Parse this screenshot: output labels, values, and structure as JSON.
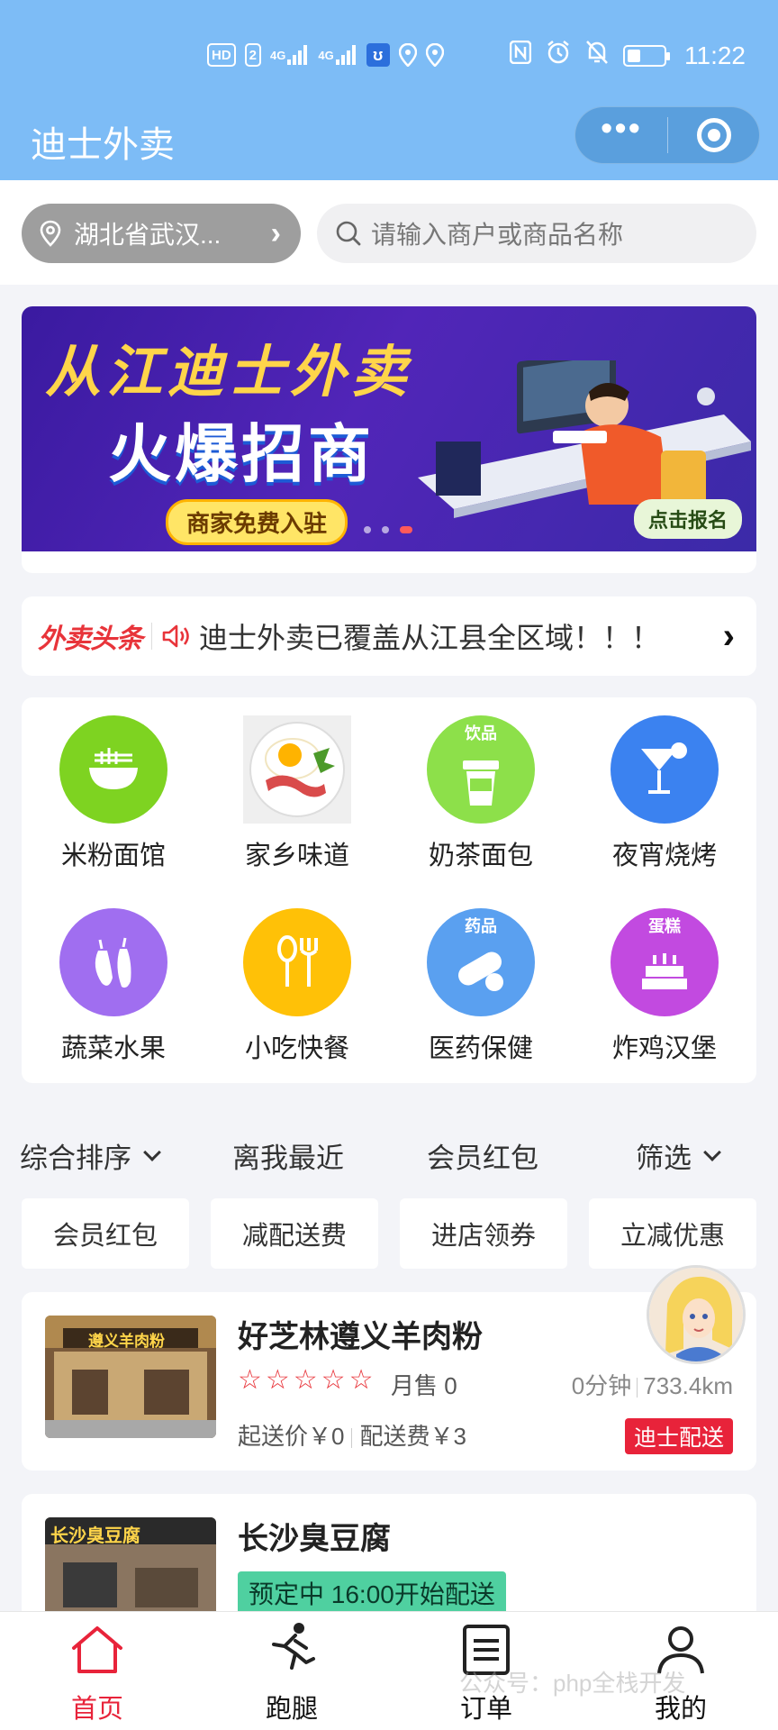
{
  "status": {
    "left_badges": [
      "HD",
      "2",
      "4G",
      "4G"
    ],
    "time": "11:22"
  },
  "header": {
    "title": "迪士外卖",
    "more_label": "•••"
  },
  "location": {
    "text": "湖北省武汉..."
  },
  "search": {
    "placeholder": "请输入商户或商品名称"
  },
  "banner": {
    "line1": "从江迪士外卖",
    "line2": "火爆招商",
    "button": "商家免费入驻",
    "signup": "点击报名"
  },
  "news": {
    "brand": "外卖头条",
    "message": "迪士外卖已覆盖从江县全区域！！！"
  },
  "categories": [
    {
      "label": "米粉面馆",
      "icon": "noodle-bowl-icon",
      "color": "#7ed321"
    },
    {
      "label": "家乡味道",
      "icon": "egg-bacon-icon",
      "color": "#f5f5f5"
    },
    {
      "label": "奶茶面包",
      "icon": "milk-tea-icon",
      "color": "#8de04a",
      "tag": "饮品"
    },
    {
      "label": "夜宵烧烤",
      "icon": "cocktail-icon",
      "color": "#3b82f0"
    },
    {
      "label": "蔬菜水果",
      "icon": "eggplant-icon",
      "color": "#a06ef0"
    },
    {
      "label": "小吃快餐",
      "icon": "spoon-fork-icon",
      "color": "#ffc107"
    },
    {
      "label": "医药保健",
      "icon": "pill-icon",
      "color": "#5aa0f0",
      "tag": "药品"
    },
    {
      "label": "炸鸡汉堡",
      "icon": "cake-icon",
      "color": "#c24ae0",
      "tag": "蛋糕"
    }
  ],
  "sort": {
    "items": [
      "综合排序",
      "离我最近",
      "会员红包",
      "筛选"
    ]
  },
  "chips": [
    "会员红包",
    "减配送费",
    "进店领券",
    "立减优惠"
  ],
  "shops": [
    {
      "name": "好芝林遵义羊肉粉",
      "stars": "☆☆☆☆☆",
      "sales": "月售 0",
      "time": "0分钟",
      "distance": "733.4km",
      "min_order": "起送价￥0",
      "delivery_fee": "配送费￥3",
      "delivery_tag": "迪士配送",
      "sign": "遵义羊肉粉"
    },
    {
      "name": "长沙臭豆腐",
      "preorder": "预定中 16:00开始配送",
      "sign": "长沙臭豆腐"
    }
  ],
  "tabs": [
    {
      "label": "首页",
      "icon": "home-icon",
      "active": true
    },
    {
      "label": "跑腿",
      "icon": "runner-icon",
      "active": false
    },
    {
      "label": "订单",
      "icon": "order-icon",
      "active": false
    },
    {
      "label": "我的",
      "icon": "user-icon",
      "active": false
    }
  ],
  "watermark": "公众号：php全栈开发",
  "colors": {
    "header_bg": "#7dbcf6",
    "accent_red": "#e8233a",
    "page_bg": "#f3f4f8"
  }
}
